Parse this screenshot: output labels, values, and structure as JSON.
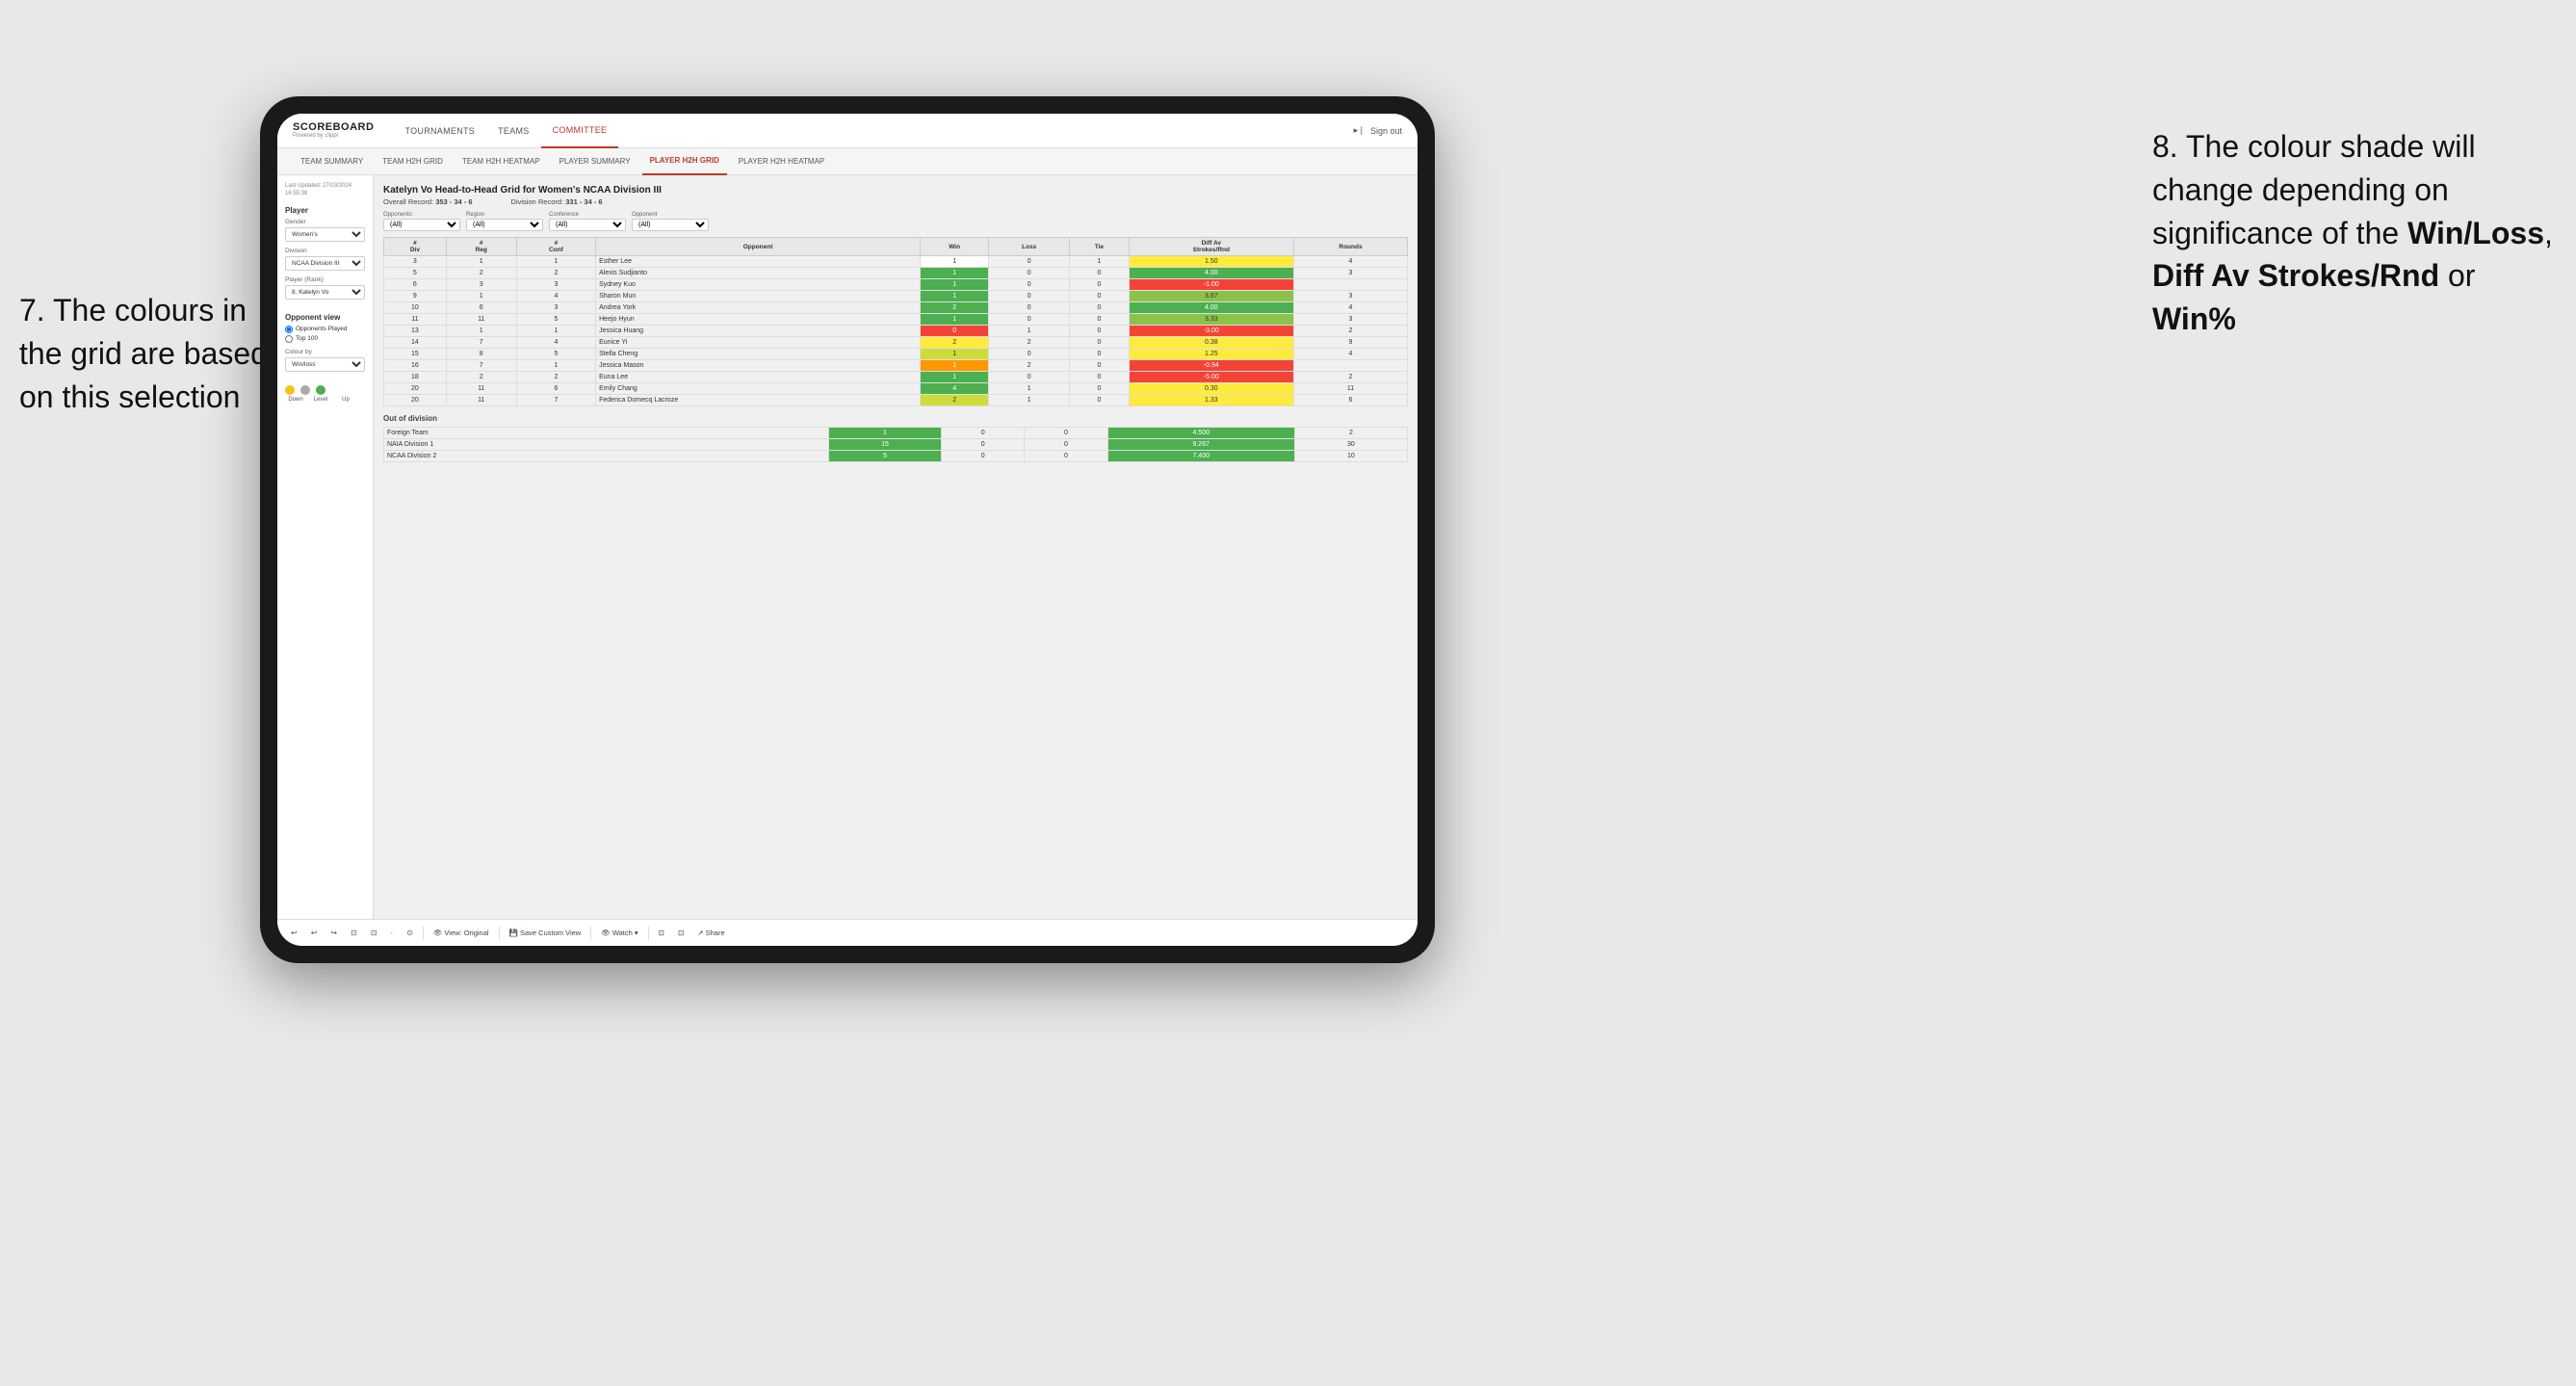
{
  "annotations": {
    "left": {
      "text": "7. The colours in the grid are based on this selection",
      "arrow_target": "colour-by selector"
    },
    "right": {
      "heading": "8. The colour shade will change depending on significance of the",
      "bold1": "Win/Loss",
      "bold2": "Diff Av Strokes/Rnd",
      "bold3": "Win%"
    }
  },
  "app": {
    "logo_main": "SCOREBOARD",
    "logo_sub": "Powered by clippi",
    "nav_items": [
      "TOURNAMENTS",
      "TEAMS",
      "COMMITTEE"
    ],
    "nav_right": [
      "Sign out"
    ],
    "sub_nav_items": [
      "TEAM SUMMARY",
      "TEAM H2H GRID",
      "TEAM H2H HEATMAP",
      "PLAYER SUMMARY",
      "PLAYER H2H GRID",
      "PLAYER H2H HEATMAP"
    ],
    "active_sub_nav": "PLAYER H2H GRID"
  },
  "sidebar": {
    "timestamp_label": "Last Updated: 27/03/2024",
    "timestamp_time": "16:55:38",
    "player_section_title": "Player",
    "gender_label": "Gender",
    "gender_value": "Women's",
    "division_label": "Division",
    "division_value": "NCAA Division III",
    "player_rank_label": "Player (Rank)",
    "player_rank_value": "8. Katelyn Vo",
    "opponent_view_title": "Opponent view",
    "radio_opponents_played": "Opponents Played",
    "radio_top100": "Top 100",
    "colour_by_label": "Colour by",
    "colour_by_value": "Win/loss",
    "legend_labels": [
      "Down",
      "Level",
      "Up"
    ],
    "legend_colors": [
      "#f9c413",
      "#aaaaaa",
      "#4caf50"
    ]
  },
  "grid": {
    "title": "Katelyn Vo Head-to-Head Grid for Women's NCAA Division III",
    "overall_record_label": "Overall Record:",
    "overall_record_value": "353 - 34 - 6",
    "division_record_label": "Division Record:",
    "division_record_value": "331 - 34 - 6",
    "filter_opponents_label": "Opponents:",
    "filter_opponents_value": "(All)",
    "filter_region_label": "Region",
    "filter_region_value": "(All)",
    "filter_conference_label": "Conference",
    "filter_conference_value": "(All)",
    "filter_opponent_label": "Opponent",
    "filter_opponent_value": "(All)",
    "table_headers": [
      "#\nDiv",
      "#\nReg",
      "#\nConf",
      "Opponent",
      "Win",
      "Loss",
      "Tie",
      "Diff Av\nStrokes/Rnd",
      "Rounds"
    ],
    "rows": [
      {
        "div": "3",
        "reg": "1",
        "conf": "1",
        "opponent": "Esther Lee",
        "win": 1,
        "loss": 0,
        "tie": 1,
        "diff": "1.50",
        "rounds": "4",
        "win_color": "white",
        "diff_color": "yellow"
      },
      {
        "div": "5",
        "reg": "2",
        "conf": "2",
        "opponent": "Alexis Sudjianto",
        "win": 1,
        "loss": 0,
        "tie": 0,
        "diff": "4.00",
        "rounds": "3",
        "win_color": "green-dark",
        "diff_color": "green-dark"
      },
      {
        "div": "6",
        "reg": "3",
        "conf": "3",
        "opponent": "Sydney Kuo",
        "win": 1,
        "loss": 0,
        "tie": 0,
        "diff": "-1.00",
        "rounds": "",
        "win_color": "green-dark",
        "diff_color": "red"
      },
      {
        "div": "9",
        "reg": "1",
        "conf": "4",
        "opponent": "Sharon Mun",
        "win": 1,
        "loss": 0,
        "tie": 0,
        "diff": "3.67",
        "rounds": "3",
        "win_color": "green-dark",
        "diff_color": "green-mid"
      },
      {
        "div": "10",
        "reg": "6",
        "conf": "3",
        "opponent": "Andrea York",
        "win": 2,
        "loss": 0,
        "tie": 0,
        "diff": "4.00",
        "rounds": "4",
        "win_color": "green-dark",
        "diff_color": "green-dark"
      },
      {
        "div": "11",
        "reg": "11",
        "conf": "5",
        "opponent": "Heejo Hyun",
        "win": 1,
        "loss": 0,
        "tie": 0,
        "diff": "3.33",
        "rounds": "3",
        "win_color": "green-dark",
        "diff_color": "green-mid"
      },
      {
        "div": "13",
        "reg": "1",
        "conf": "1",
        "opponent": "Jessica Huang",
        "win": 0,
        "loss": 1,
        "tie": 0,
        "diff": "-3.00",
        "rounds": "2",
        "win_color": "red",
        "diff_color": "red"
      },
      {
        "div": "14",
        "reg": "7",
        "conf": "4",
        "opponent": "Eunice Yi",
        "win": 2,
        "loss": 2,
        "tie": 0,
        "diff": "0.38",
        "rounds": "9",
        "win_color": "yellow",
        "diff_color": "yellow"
      },
      {
        "div": "15",
        "reg": "8",
        "conf": "5",
        "opponent": "Stella Cheng",
        "win": 1,
        "loss": 0,
        "tie": 0,
        "diff": "1.25",
        "rounds": "4",
        "win_color": "green-light",
        "diff_color": "yellow"
      },
      {
        "div": "16",
        "reg": "7",
        "conf": "1",
        "opponent": "Jessica Mason",
        "win": 1,
        "loss": 2,
        "tie": 0,
        "diff": "-0.94",
        "rounds": "",
        "win_color": "orange",
        "diff_color": "red"
      },
      {
        "div": "18",
        "reg": "2",
        "conf": "2",
        "opponent": "Euna Lee",
        "win": 1,
        "loss": 0,
        "tie": 0,
        "diff": "-5.00",
        "rounds": "2",
        "win_color": "green-dark",
        "diff_color": "red"
      },
      {
        "div": "20",
        "reg": "11",
        "conf": "6",
        "opponent": "Emily Chang",
        "win": 4,
        "loss": 1,
        "tie": 0,
        "diff": "0.30",
        "rounds": "11",
        "win_color": "green-dark",
        "diff_color": "yellow"
      },
      {
        "div": "20",
        "reg": "11",
        "conf": "7",
        "opponent": "Federica Domecq Lacroze",
        "win": 2,
        "loss": 1,
        "tie": 0,
        "diff": "1.33",
        "rounds": "6",
        "win_color": "green-light",
        "diff_color": "yellow"
      }
    ],
    "out_of_division_title": "Out of division",
    "out_of_division_rows": [
      {
        "opponent": "Foreign Team",
        "win": 1,
        "loss": 0,
        "tie": 0,
        "diff": "4.500",
        "rounds": "2",
        "win_color": "green-dark",
        "diff_color": "green-dark"
      },
      {
        "opponent": "NAIA Division 1",
        "win": 15,
        "loss": 0,
        "tie": 0,
        "diff": "9.267",
        "rounds": "30",
        "win_color": "green-dark",
        "diff_color": "green-dark"
      },
      {
        "opponent": "NCAA Division 2",
        "win": 5,
        "loss": 0,
        "tie": 0,
        "diff": "7.400",
        "rounds": "10",
        "win_color": "green-dark",
        "diff_color": "green-dark"
      }
    ]
  },
  "toolbar": {
    "buttons": [
      "↩",
      "↩",
      "↪",
      "⊡",
      "⊡",
      "·",
      "⊙"
    ],
    "view_original_label": "View: Original",
    "save_custom_label": "Save Custom View",
    "watch_label": "Watch",
    "share_label": "Share"
  }
}
